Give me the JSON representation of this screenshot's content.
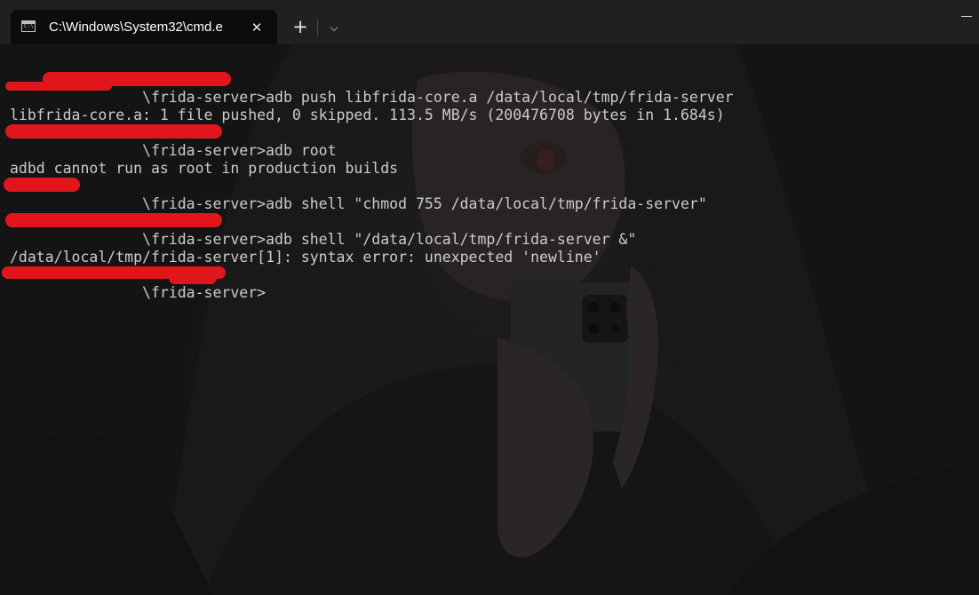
{
  "window": {
    "tab": {
      "icon_glyph": "C:\\",
      "icon": "cmd-prompt-icon",
      "title": "C:\\Windows\\System32\\cmd.e",
      "close_glyph": "✕"
    },
    "new_tab_glyph": "+",
    "dropdown_glyph": "⌵"
  },
  "terminal": {
    "lines": [
      "",
      "               \\frida-server>adb push libfrida-core.a /data/local/tmp/frida-server",
      "libfrida-core.a: 1 file pushed, 0 skipped. 113.5 MB/s (200476708 bytes in 1.684s)",
      "",
      "               \\frida-server>adb root",
      "adbd cannot run as root in production builds",
      "",
      "               \\frida-server>adb shell \"chmod 755 /data/local/tmp/frida-server\"",
      "",
      "               \\frida-server>adb shell \"/data/local/tmp/frida-server &\"",
      "/data/local/tmp/frida-server[1]: syntax error: unexpected 'newline'",
      "",
      "               \\frida-server>"
    ],
    "text_color": "#cccccc",
    "redaction_color": "#e0161a"
  }
}
